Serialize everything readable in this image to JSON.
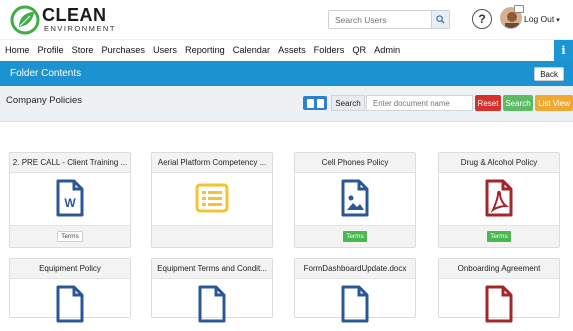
{
  "brand": {
    "name": "CLEAN",
    "tagline": "ENVIRONMENT"
  },
  "header": {
    "search_placeholder": "Search Users",
    "help_label": "?",
    "logout_label": "Log Out"
  },
  "nav": {
    "items": [
      "Home",
      "Profile",
      "Store",
      "Purchases",
      "Users",
      "Reporting",
      "Calendar",
      "Assets",
      "Folders",
      "QR",
      "Admin"
    ],
    "info_label": "i"
  },
  "folder": {
    "title": "Folder Contents",
    "back_label": "Back"
  },
  "subheader": {
    "title": "Company Policies",
    "search_label": "Search",
    "doc_placeholder": "Enter document name",
    "reset_label": "Reset",
    "search_button": "Search",
    "list_view_label": "List View"
  },
  "colors": {
    "accent": "#1c93d0",
    "word_icon": "#2b5797",
    "list_icon": "#f4c430",
    "image_icon": "#2b5797",
    "pdf_icon": "#a3262a",
    "terms_green": "#4bb84f"
  },
  "cards": [
    {
      "title": "2. PRE CALL - Client Training ...",
      "icon": "word-doc-icon",
      "terms": "Terms",
      "terms_style": "plain"
    },
    {
      "title": "Aerial Platform Competency ...",
      "icon": "list-doc-icon",
      "terms": "",
      "terms_style": "none"
    },
    {
      "title": "Cell Phones Policy",
      "icon": "image-doc-icon",
      "terms": "Terms",
      "terms_style": "green"
    },
    {
      "title": "Drug & Alcohol Policy",
      "icon": "pdf-doc-icon",
      "terms": "Terms",
      "terms_style": "green"
    },
    {
      "title": "Equipment Policy",
      "icon": "word-doc-icon",
      "terms": "",
      "terms_style": "none"
    },
    {
      "title": "Equipment Terms and Condit...",
      "icon": "word-doc-icon",
      "terms": "",
      "terms_style": "none"
    },
    {
      "title": "FormDashboardUpdate.docx",
      "icon": "image-doc-icon",
      "terms": "",
      "terms_style": "none"
    },
    {
      "title": "Onboarding Agreement",
      "icon": "pdf-doc-icon",
      "terms": "",
      "terms_style": "none"
    }
  ]
}
